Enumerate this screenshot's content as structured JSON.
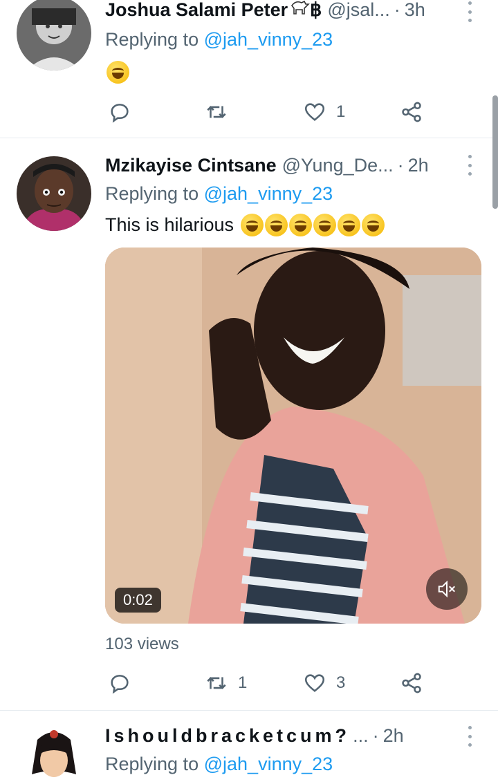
{
  "tweets": [
    {
      "name": "Joshua Salami Peter",
      "name_suffix": "฿",
      "handle": "@jsal...",
      "time": "3h",
      "replying_label": "Replying to",
      "replying_to": "@jah_vinny_23",
      "text": "",
      "emoji_count": 1,
      "retweets": "",
      "likes": "1"
    },
    {
      "name": "Mzikayise Cintsane",
      "handle": "@Yung_De...",
      "time": "2h",
      "replying_label": "Replying to",
      "replying_to": "@jah_vinny_23",
      "text": "This is hilarious",
      "emoji_count": 6,
      "video_duration": "0:02",
      "views": "103 views",
      "retweets": "1",
      "likes": "3"
    },
    {
      "name": "Ishouldbracketcum?",
      "handle": "...",
      "time": "2h",
      "replying_label": "Replying to",
      "replying_to": "@jah_vinny_23"
    }
  ],
  "dot": "·",
  "icons": {
    "reply": "reply-icon",
    "retweet": "retweet-icon",
    "like": "heart-icon",
    "share": "share-icon",
    "mute": "mute-icon",
    "more": "more-options-icon"
  },
  "colors": {
    "link": "#1d9bf0",
    "secondary_text": "#536471",
    "divider": "#e6ecf0"
  }
}
